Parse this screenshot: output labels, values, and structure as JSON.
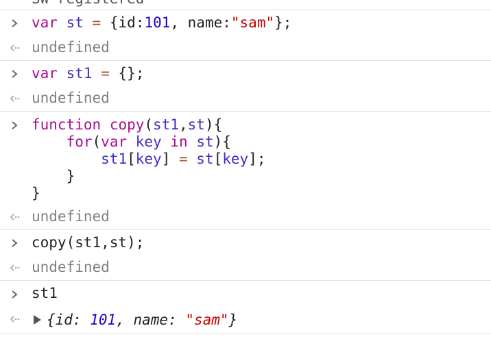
{
  "top_partial": {
    "text": "SW registered"
  },
  "entries": [
    {
      "input": [
        "var st = {id:101, name:\"sam\"};"
      ],
      "output": "undefined"
    },
    {
      "input": [
        "var st1 = {};"
      ],
      "output": "undefined"
    },
    {
      "input": [
        "function copy(st1,st){",
        "    for(var key in st){",
        "        st1[key] = st[key];",
        "    }",
        "}"
      ],
      "output": "undefined"
    },
    {
      "input": [
        "copy(st1,st);"
      ],
      "output": "undefined"
    },
    {
      "input": [
        "st1"
      ],
      "output_object": {
        "open": "{",
        "key1": "id",
        "sep1": ": ",
        "val1": "101",
        "comma": ", ",
        "key2": "name",
        "sep2": ": ",
        "val2": "\"sam\"",
        "close": "}"
      }
    }
  ],
  "colors": {
    "keyword": "#aa0d91",
    "variable": "#3f2fc0",
    "number": "#1c00cf",
    "string": "#c80000",
    "undefined": "#808080",
    "divider": "#e2e2e2"
  },
  "icons": {
    "prompt": "chevron-right-icon",
    "result": "return-arrow-icon",
    "expand": "triangle-right-icon"
  }
}
